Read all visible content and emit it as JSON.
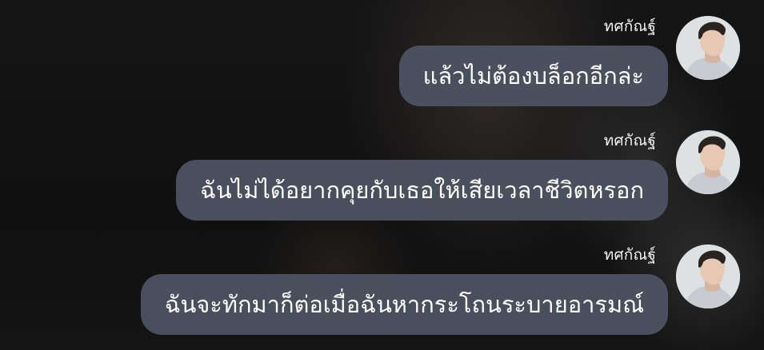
{
  "chat": {
    "messages": [
      {
        "sender": "ทศกัณฐ์",
        "text": "แล้วไม่ต้องบล็อกอีกล่ะ"
      },
      {
        "sender": "ทศกัณฐ์",
        "text": "ฉันไม่ได้อยากคุยกับเธอให้เสียเวลาชีวิตหรอก"
      },
      {
        "sender": "ทศกัณฐ์",
        "text": "ฉันจะทักมาก็ต่อเมื่อฉันหากระโถนระบายอารมณ์"
      }
    ]
  },
  "colors": {
    "bubble": "#4c5260",
    "text": "#ffffff",
    "background": "#0f0f10"
  },
  "icons": {
    "avatar": "profile-avatar"
  }
}
